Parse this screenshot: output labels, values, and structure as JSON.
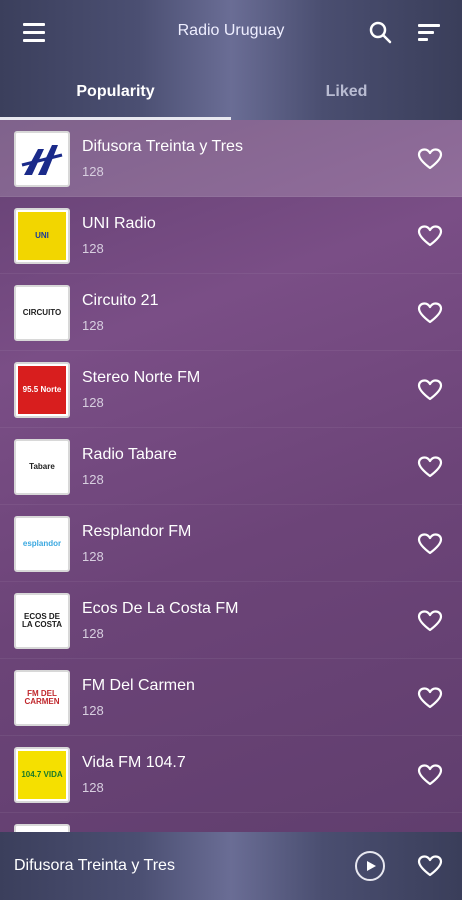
{
  "app": {
    "title": "Radio Uruguay"
  },
  "icons": {
    "menu": "menu-icon",
    "search": "search-icon",
    "sort": "sort-icon",
    "favorite": "heart-outline-icon",
    "play": "play-circle-icon"
  },
  "tabs": [
    {
      "label": "Popularity",
      "selected": true
    },
    {
      "label": "Liked",
      "selected": false
    }
  ],
  "stations": [
    {
      "name": "Difusora Treinta y Tres",
      "bitrate": "128",
      "logo_text": "",
      "logo_bg": "#ffffff",
      "logo_fg": "#1a2a8a",
      "selected": true
    },
    {
      "name": "UNI Radio",
      "bitrate": "128",
      "logo_text": "UNI",
      "logo_bg": "#f2d600",
      "logo_fg": "#1a3a9a",
      "selected": false
    },
    {
      "name": "Circuito 21",
      "bitrate": "128",
      "logo_text": "CIRCUITO",
      "logo_bg": "#ffffff",
      "logo_fg": "#222222",
      "selected": false
    },
    {
      "name": "Stereo Norte FM",
      "bitrate": "128",
      "logo_text": "95.5 Norte",
      "logo_bg": "#d81e1e",
      "logo_fg": "#ffffff",
      "selected": false
    },
    {
      "name": "Radio Tabare",
      "bitrate": "128",
      "logo_text": "Tabare",
      "logo_bg": "#ffffff",
      "logo_fg": "#222222",
      "selected": false
    },
    {
      "name": "Resplandor FM",
      "bitrate": "128",
      "logo_text": "esplandor",
      "logo_bg": "#ffffff",
      "logo_fg": "#3aa8e0",
      "selected": false
    },
    {
      "name": "Ecos De La Costa FM",
      "bitrate": "128",
      "logo_text": "ECOS DE LA COSTA",
      "logo_bg": "#ffffff",
      "logo_fg": "#1a1a1a",
      "selected": false
    },
    {
      "name": "FM Del Carmen",
      "bitrate": "128",
      "logo_text": "FM DEL CARMEN",
      "logo_bg": "#ffffff",
      "logo_fg": "#c0282d",
      "selected": false
    },
    {
      "name": "Vida FM 104.7",
      "bitrate": "128",
      "logo_text": "104.7 VIDA",
      "logo_bg": "#f5e000",
      "logo_fg": "#1a7a2a",
      "selected": false
    },
    {
      "name": "",
      "bitrate": "",
      "logo_text": "",
      "logo_bg": "#ffffff",
      "logo_fg": "#222222",
      "selected": false
    }
  ],
  "player": {
    "now_playing": "Difusora Treinta y Tres"
  }
}
